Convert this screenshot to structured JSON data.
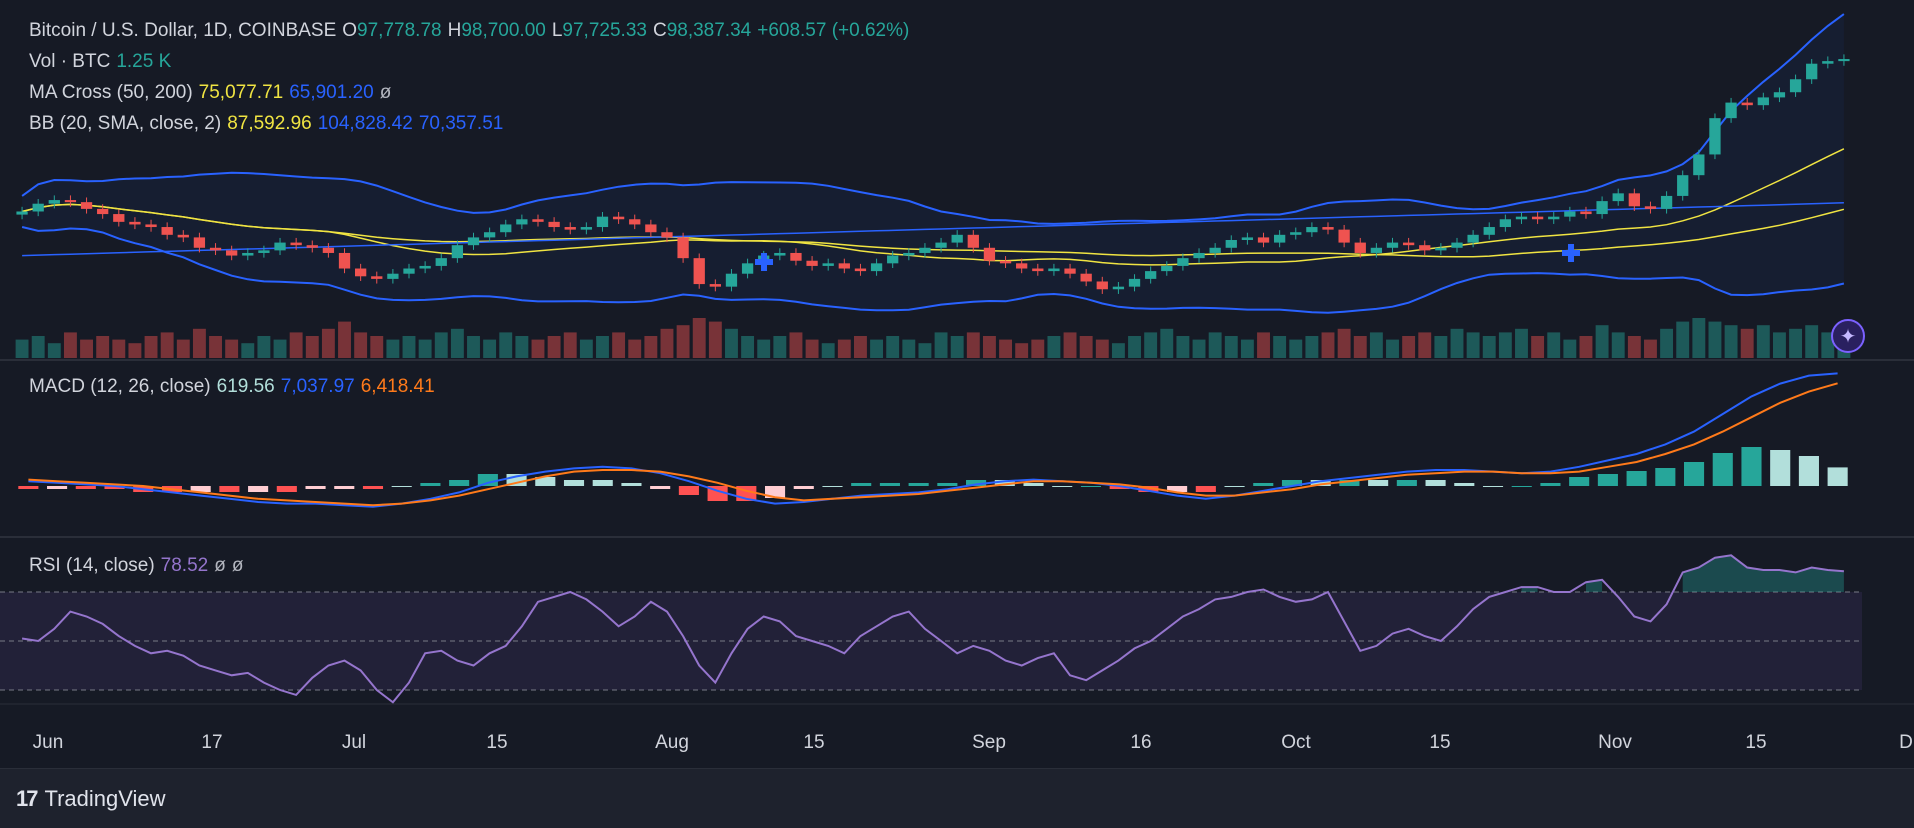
{
  "main_legend": {
    "symbol": "Bitcoin / U.S. Dollar, 1D, COINBASE",
    "o_label": "O",
    "o_value": "97,778.78",
    "h_label": "H",
    "h_value": "98,700.00",
    "l_label": "L",
    "l_value": "97,725.33",
    "c_label": "C",
    "c_value": "98,387.34",
    "change": "+608.57 (+0.62%)"
  },
  "vol_legend": {
    "label": "Vol · BTC",
    "value": "1.25 K"
  },
  "ma_legend": {
    "label": "MA Cross (50, 200)",
    "v1": "75,077.71",
    "v2": "65,901.20",
    "v3": "ø"
  },
  "bb_legend": {
    "label": "BB (20, SMA, close, 2)",
    "v1": "87,592.96",
    "v2": "104,828.42",
    "v3": "70,357.51"
  },
  "macd_legend": {
    "label": "MACD (12, 26, close)",
    "v1": "619.56",
    "v2": "7,037.97",
    "v3": "6,418.41"
  },
  "rsi_legend": {
    "label": "RSI (14, close)",
    "v1": "78.52",
    "v2": "ø",
    "v3": "ø"
  },
  "brand": {
    "name": "TradingView"
  },
  "colors": {
    "up": "#26a69a",
    "down": "#ef5350",
    "bb": "#2962ff",
    "ma_fast": "#f0e442",
    "ma_slow": "#2962ff",
    "sma": "#f0e442",
    "macd": "#2962ff",
    "signal": "#ff7a1a",
    "rsi": "#9575cd",
    "background": "#161a25"
  },
  "chart_data": {
    "type": "candlestick",
    "x_ticks": [
      "Jun",
      "17",
      "Jul",
      "15",
      "Aug",
      "15",
      "Sep",
      "16",
      "Oct",
      "15",
      "Nov",
      "15",
      "D"
    ],
    "price_close_series": [
      69000,
      70500,
      71200,
      70800,
      69500,
      68500,
      67000,
      66500,
      66000,
      64500,
      64000,
      62000,
      61500,
      60500,
      61000,
      61500,
      63000,
      62500,
      62000,
      61000,
      58000,
      56500,
      56000,
      57000,
      58000,
      58500,
      60000,
      62500,
      64000,
      65000,
      66500,
      67500,
      67000,
      66000,
      65500,
      66000,
      68000,
      67500,
      66500,
      65000,
      64000,
      60000,
      55000,
      54500,
      57000,
      59000,
      60500,
      61000,
      59500,
      58500,
      59000,
      58000,
      57500,
      59000,
      60500,
      61000,
      62000,
      63000,
      64500,
      62000,
      59500,
      59000,
      58000,
      57500,
      58000,
      57000,
      55500,
      54000,
      54500,
      56000,
      57500,
      58500,
      60000,
      61000,
      62000,
      63500,
      64000,
      63000,
      64500,
      65000,
      66000,
      65500,
      63000,
      61000,
      62000,
      63000,
      62500,
      61500,
      62000,
      63000,
      64500,
      66000,
      67500,
      68000,
      67500,
      68000,
      69000,
      68500,
      71000,
      72500,
      70000,
      69500,
      72000,
      76000,
      80000,
      87000,
      90000,
      89500,
      91000,
      92000,
      94500,
      97500,
      98000,
      98400
    ],
    "volume_relative": [
      0.4,
      0.5,
      0.3,
      0.6,
      0.4,
      0.5,
      0.4,
      0.3,
      0.5,
      0.6,
      0.4,
      0.7,
      0.5,
      0.4,
      0.3,
      0.5,
      0.4,
      0.6,
      0.5,
      0.7,
      0.9,
      0.6,
      0.5,
      0.4,
      0.5,
      0.4,
      0.6,
      0.7,
      0.5,
      0.4,
      0.6,
      0.5,
      0.4,
      0.5,
      0.6,
      0.4,
      0.5,
      0.6,
      0.4,
      0.5,
      0.7,
      0.8,
      1.0,
      0.9,
      0.7,
      0.5,
      0.4,
      0.5,
      0.6,
      0.4,
      0.3,
      0.4,
      0.5,
      0.4,
      0.5,
      0.4,
      0.3,
      0.6,
      0.5,
      0.6,
      0.5,
      0.4,
      0.3,
      0.4,
      0.5,
      0.6,
      0.5,
      0.4,
      0.3,
      0.5,
      0.6,
      0.7,
      0.5,
      0.4,
      0.6,
      0.5,
      0.4,
      0.6,
      0.5,
      0.4,
      0.5,
      0.6,
      0.7,
      0.5,
      0.6,
      0.4,
      0.5,
      0.6,
      0.5,
      0.7,
      0.6,
      0.5,
      0.6,
      0.7,
      0.5,
      0.6,
      0.4,
      0.5,
      0.8,
      0.6,
      0.5,
      0.4,
      0.7,
      0.9,
      1.0,
      0.9,
      0.8,
      0.7,
      0.8,
      0.6,
      0.7,
      0.8,
      0.6,
      0.3
    ],
    "rsi_series": [
      51,
      50,
      55,
      62,
      60,
      57,
      52,
      48,
      45,
      46,
      44,
      40,
      38,
      36,
      37,
      33,
      30,
      28,
      35,
      40,
      42,
      38,
      30,
      25,
      33,
      45,
      46,
      42,
      40,
      45,
      48,
      56,
      66,
      68,
      70,
      67,
      62,
      56,
      60,
      66,
      62,
      52,
      40,
      33,
      45,
      55,
      60,
      58,
      52,
      50,
      48,
      45,
      52,
      56,
      60,
      62,
      55,
      50,
      45,
      48,
      46,
      42,
      40,
      43,
      45,
      36,
      34,
      38,
      42,
      47,
      50,
      55,
      60,
      63,
      67,
      68,
      70,
      71,
      68,
      66,
      67,
      70,
      58,
      46,
      48,
      53,
      55,
      52,
      50,
      56,
      63,
      68,
      70,
      72,
      72,
      70,
      70,
      74,
      75,
      68,
      60,
      58,
      65,
      78,
      80,
      84,
      85,
      80,
      79,
      79,
      78,
      80,
      79,
      78.5
    ],
    "macd_series": [
      0.3,
      0.2,
      0.1,
      0.0,
      -0.2,
      -0.4,
      -0.6,
      -0.8,
      -1.0,
      -1.1,
      -1.1,
      -1.2,
      -1.3,
      -1.1,
      -0.8,
      -0.4,
      0.2,
      0.6,
      0.9,
      1.1,
      1.2,
      1.1,
      0.8,
      0.3,
      -0.3,
      -0.8,
      -1.1,
      -1.0,
      -0.8,
      -0.6,
      -0.5,
      -0.4,
      -0.2,
      0.1,
      0.3,
      0.4,
      0.3,
      0.2,
      0.0,
      -0.3,
      -0.6,
      -0.8,
      -0.6,
      -0.3,
      0.0,
      0.3,
      0.5,
      0.7,
      0.9,
      1.0,
      1.0,
      0.9,
      0.8,
      0.9,
      1.2,
      1.6,
      2.0,
      2.6,
      3.4,
      4.5,
      5.6,
      6.4,
      6.9,
      7.04
    ],
    "signal_series": [
      0.4,
      0.3,
      0.2,
      0.1,
      0.0,
      -0.2,
      -0.4,
      -0.6,
      -0.8,
      -0.9,
      -1.0,
      -1.1,
      -1.2,
      -1.1,
      -0.9,
      -0.6,
      -0.2,
      0.2,
      0.6,
      0.9,
      1.0,
      1.0,
      0.9,
      0.6,
      0.2,
      -0.3,
      -0.7,
      -0.9,
      -0.8,
      -0.7,
      -0.6,
      -0.5,
      -0.3,
      -0.1,
      0.1,
      0.3,
      0.3,
      0.2,
      0.1,
      -0.1,
      -0.4,
      -0.6,
      -0.6,
      -0.4,
      -0.2,
      0.1,
      0.3,
      0.5,
      0.7,
      0.8,
      0.9,
      0.9,
      0.8,
      0.8,
      0.9,
      1.2,
      1.5,
      2.0,
      2.6,
      3.4,
      4.3,
      5.2,
      5.9,
      6.42
    ]
  }
}
